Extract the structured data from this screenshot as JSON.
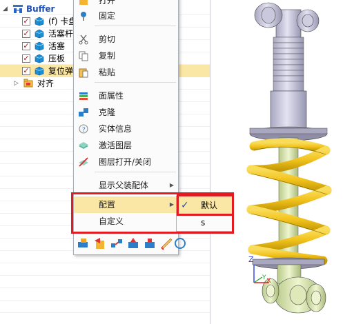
{
  "tree": {
    "root_label": "Buffer",
    "items": [
      {
        "label": "(f) 卡盘",
        "checked": true
      },
      {
        "label": "活塞杆",
        "checked": true
      },
      {
        "label": "活塞",
        "checked": true
      },
      {
        "label": "压板",
        "checked": true
      },
      {
        "label": "复位弹",
        "checked": true,
        "selected": true
      }
    ],
    "align_label": "对齐"
  },
  "context_menu": {
    "items": [
      {
        "label": "打开",
        "icon": "open-icon"
      },
      {
        "label": "固定",
        "icon": "pin-icon"
      },
      {
        "label": "剪切",
        "icon": "scissors-icon"
      },
      {
        "label": "复制",
        "icon": "copy-icon"
      },
      {
        "label": "粘贴",
        "icon": "paste-icon"
      },
      {
        "label": "面属性",
        "icon": "face-attributes-icon"
      },
      {
        "label": "克隆",
        "icon": "clone-icon"
      },
      {
        "label": "实体信息",
        "icon": "entity-info-icon"
      },
      {
        "label": "激活图层",
        "icon": "activate-layer-icon"
      },
      {
        "label": "图层打开/关闭",
        "icon": "layer-toggle-icon"
      },
      {
        "label": "显示父装配体"
      },
      {
        "label": "配置"
      },
      {
        "label": "自定义"
      }
    ]
  },
  "submenu": {
    "items": [
      {
        "label": "默认",
        "checked": true
      },
      {
        "label": "s",
        "checked": false
      }
    ]
  },
  "colors": {
    "highlight": "#fbe7a5",
    "annotation_red": "#e11b22",
    "spring": "#f2c21c",
    "body_gray": "#d4d3e4"
  },
  "axes": {
    "x": "X",
    "y": "Y",
    "z": "Z"
  }
}
